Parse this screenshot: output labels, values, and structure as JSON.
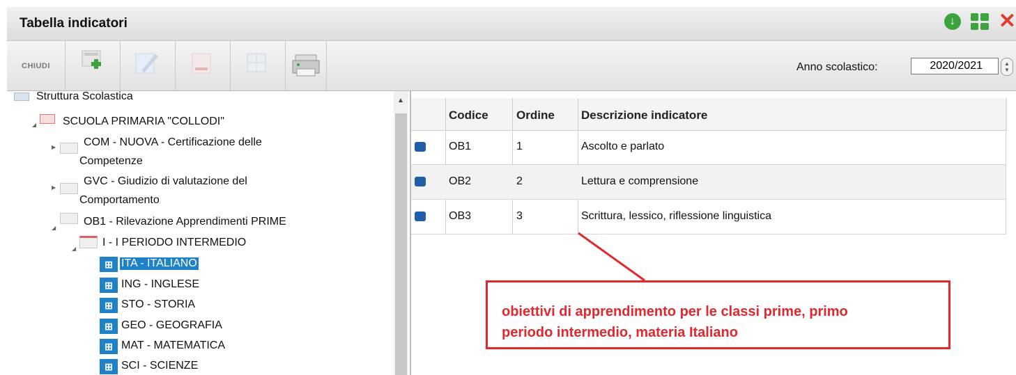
{
  "window": {
    "title": "Tabella indicatori"
  },
  "toolbar": {
    "close_label": "CHIUDI",
    "anno_label": "Anno scolastico:",
    "anno_value": "2020/2021"
  },
  "tree": {
    "root": "Struttura Scolastica",
    "school": "SCUOLA PRIMARIA \"COLLODI\"",
    "items": [
      {
        "line1": "COM - NUOVA - Certificazione delle",
        "line2": "Competenze"
      },
      {
        "line1": "GVC - Giudizio di valutazione del",
        "line2": "Comportamento"
      },
      {
        "line1": "OB1 - Rilevazione Apprendimenti PRIME"
      }
    ],
    "period": "I - I PERIODO INTERMEDIO",
    "subjects": [
      "ITA - ITALIANO",
      "ING - INGLESE",
      "STO - STORIA",
      "GEO - GEOGRAFIA",
      "MAT - MATEMATICA",
      "SCI - SCIENZE"
    ]
  },
  "table": {
    "headers": {
      "codice": "Codice",
      "ordine": "Ordine",
      "descrizione": "Descrizione indicatore"
    },
    "rows": [
      {
        "codice": "OB1",
        "ordine": "1",
        "descrizione": "Ascolto e parlato"
      },
      {
        "codice": "OB2",
        "ordine": "2",
        "descrizione": "Lettura e comprensione"
      },
      {
        "codice": "OB3",
        "ordine": "3",
        "descrizione": "Scrittura, lessico, riflessione linguistica"
      }
    ]
  },
  "annotation": {
    "line1": "obiettivi di apprendimento per le classi prime, primo",
    "line2": "periodo intermedio, materia Italiano",
    "color": "#e0282e"
  }
}
